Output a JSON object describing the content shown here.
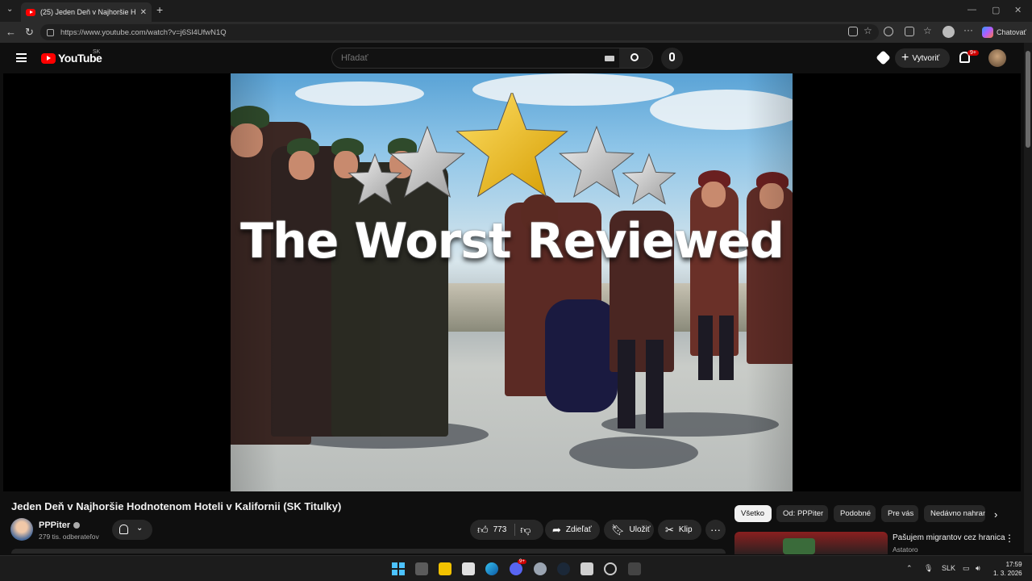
{
  "browser": {
    "tab_title": "(25) Jeden Deň v Najhoršie Hodnot",
    "url": "https://www.youtube.com/watch?v=j6Sl4UfwN1Q",
    "copilot_label": "Chatovať"
  },
  "yt_header": {
    "logo_text": "YouTube",
    "country_code": "SK",
    "search_placeholder": "Hľadať",
    "create_label": "Vytvoriť",
    "notif_badge": "9+"
  },
  "video": {
    "overlay_title": "The Worst Reviewed",
    "title": "Jeden Deň v Najhoršie Hodnotenom Hoteli v Kalifornii (SK Titulky)"
  },
  "channel": {
    "name": "PPPiter",
    "subscribers": "279 tis. odberateľov"
  },
  "actions": {
    "like_count": "773",
    "share_label": "Zdieľať",
    "save_label": "Uložiť",
    "clip_label": "Klip"
  },
  "chips": [
    "Všetko",
    "Od: PPPiter",
    "Podobné",
    "Pre vás",
    "Nedávno nahran"
  ],
  "recommended": {
    "title": "Pašujem migrantov cez hranica",
    "channel": "Astatoro"
  },
  "taskbar": {
    "lang": "SLK",
    "time": "17:59",
    "date": "1. 3. 2026",
    "discord_badge": "9+"
  },
  "colors": {
    "yt_red": "#ff0000",
    "background": "#0f0f0f",
    "chip_active": "#f1f1f1",
    "star_gold": "#f5c518"
  }
}
